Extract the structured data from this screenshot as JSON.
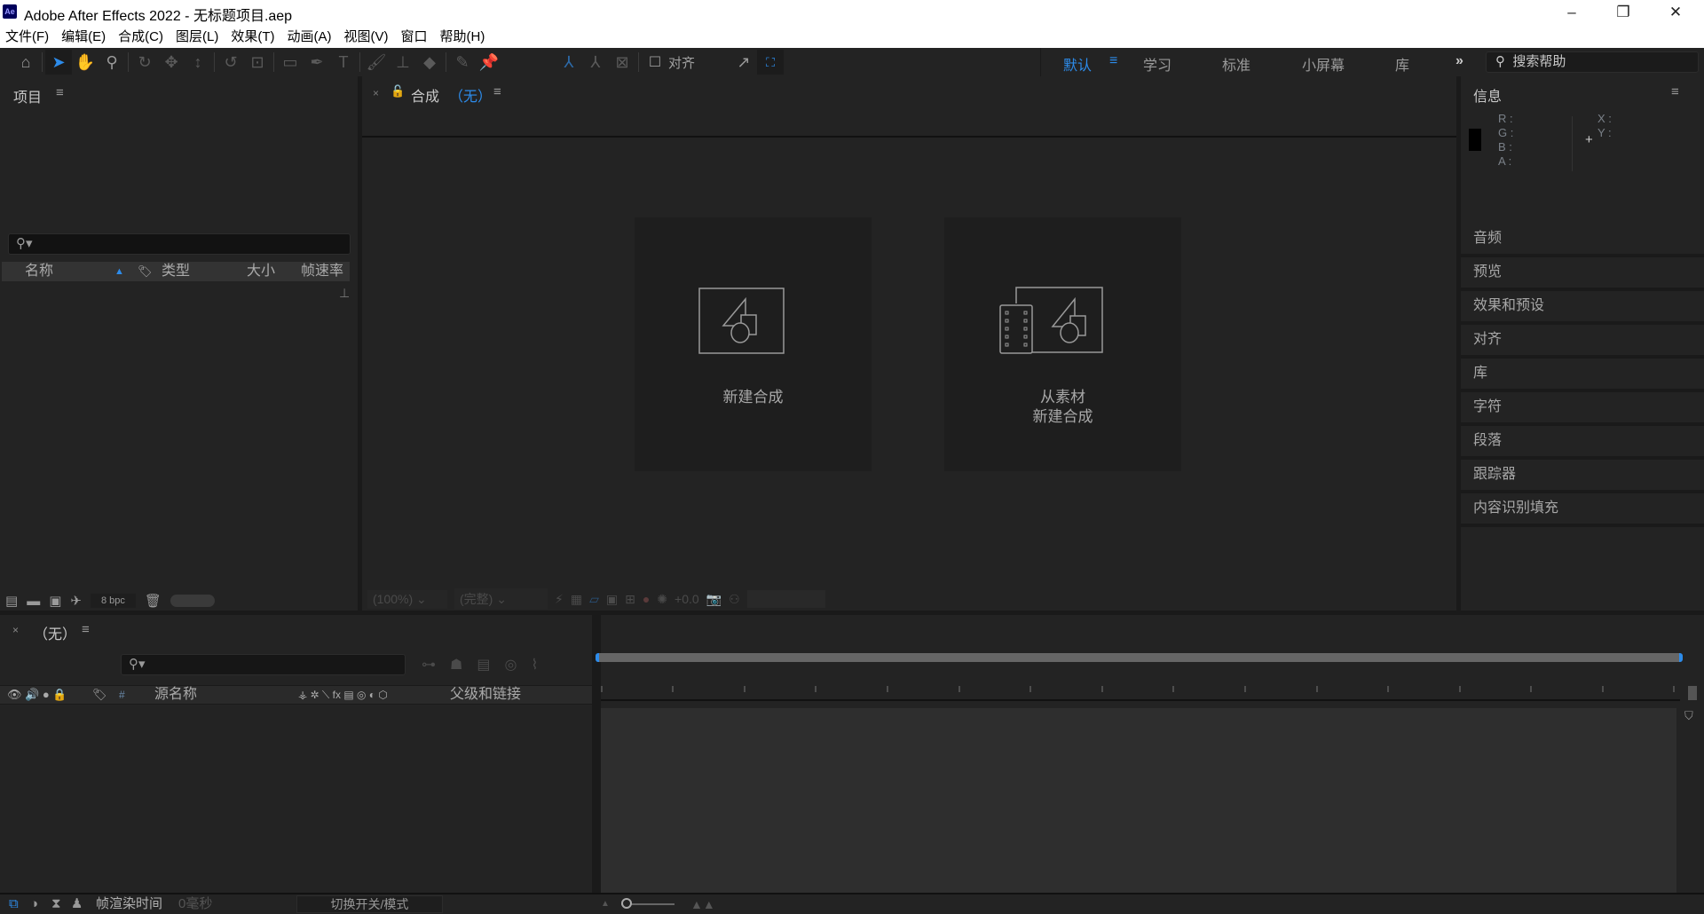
{
  "window": {
    "title": "Adobe After Effects 2022 - 无标题项目.aep",
    "app_badge": "Ae",
    "minimize": "–",
    "restore": "❐",
    "close": "✕"
  },
  "menu": [
    "文件(F)",
    "编辑(E)",
    "合成(C)",
    "图层(L)",
    "效果(T)",
    "动画(A)",
    "视图(V)",
    "窗口",
    "帮助(H)"
  ],
  "toolbar": {
    "align_label": "对齐",
    "workspaces": [
      "默认",
      "学习",
      "标准",
      "小屏幕",
      "库"
    ],
    "more": "»",
    "search_placeholder": "搜索帮助"
  },
  "project": {
    "title": "项目",
    "columns": [
      "名称",
      "类型",
      "大小",
      "帧速率"
    ],
    "bpc": "8 bpc"
  },
  "comp": {
    "title": "合成",
    "name": "（无）",
    "new_comp": "新建合成",
    "from_footage_line1": "从素材",
    "from_footage_line2": "新建合成",
    "zoom": "(100%)",
    "resolution": "(完整)",
    "exposure": "+0.0"
  },
  "info": {
    "title": "信息",
    "r": "R :",
    "g": "G :",
    "b": "B :",
    "a": "A :",
    "x": "X :",
    "y": "Y :",
    "swatch_color": "#000000"
  },
  "right_panels": [
    "音频",
    "预览",
    "效果和预设",
    "对齐",
    "库",
    "字符",
    "段落",
    "跟踪器",
    "内容识别填充"
  ],
  "timeline": {
    "tab": "（无）",
    "col_num": "#",
    "col_source": "源名称",
    "col_parent": "父级和链接",
    "render_label": "帧渲染时间",
    "render_value": "0毫秒",
    "toggle": "切换开关/模式"
  },
  "colors": {
    "accent": "#2d8ceb",
    "bg": "#232323"
  }
}
